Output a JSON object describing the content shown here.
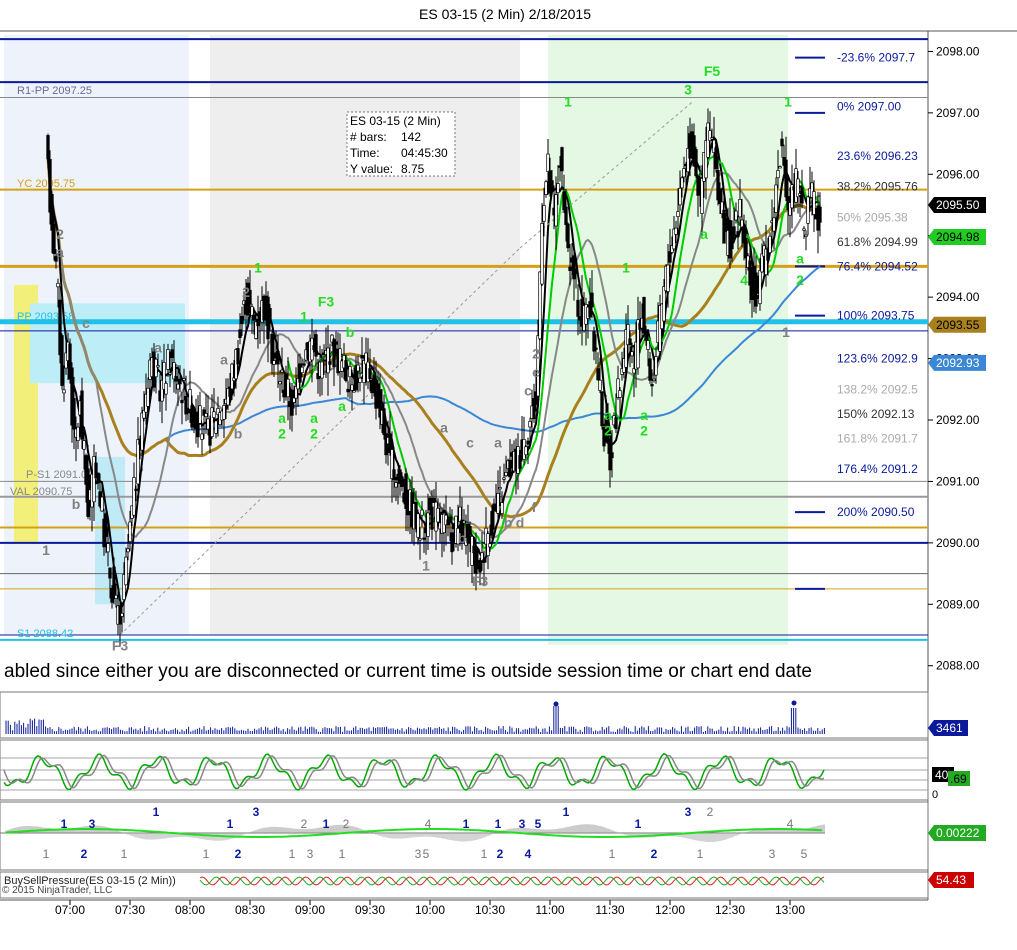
{
  "title": "ES 03-15 (2 Min)  2/18/2015",
  "colors": {
    "up": "#00c800",
    "down": "#000000",
    "navy": "#0a1a9a",
    "gold": "#d4a017",
    "brown": "#a8801e",
    "cyan": "#1fc1e8",
    "blue_ma": "#3a87d6",
    "gray_ma": "#888888",
    "label_green": "#22dd22",
    "label_gray": "#808080"
  },
  "chart_data": [
    {
      "type": "candlestick",
      "name": "price-panel",
      "title": "ES 03-15 (2 Min)  2/18/2015",
      "ylim": [
        2087.8,
        2098.3
      ],
      "y_ticks": [
        "2098.00",
        "2097.00",
        "2096.00",
        "2095.00",
        "2094.00",
        "2093.00",
        "2092.00",
        "2091.00",
        "2090.00",
        "2089.00",
        "2088.00"
      ],
      "x_ticks": [
        "07:00",
        "07:30",
        "08:00",
        "08:30",
        "09:00",
        "09:30",
        "10:00",
        "10:30",
        "11:00",
        "11:30",
        "12:00",
        "12:30",
        "13:00"
      ],
      "grid": false,
      "price_markers": [
        {
          "label": "2095.50",
          "value": 2095.5,
          "bg": "#000000",
          "fg": "#ffffff"
        },
        {
          "label": "2094.98",
          "value": 2094.98,
          "bg": "#22cc22",
          "fg": "#000000"
        },
        {
          "label": "2093.55",
          "value": 2093.55,
          "bg": "#a8801e",
          "fg": "#000000"
        },
        {
          "label": "2092.93",
          "value": 2092.93,
          "bg": "#3a87d6",
          "fg": "#ffffff"
        }
      ],
      "levels": [
        {
          "label": "R1-PP 2097.25",
          "value": 2097.25,
          "color": "#0a1a9a"
        },
        {
          "label": "YC 2095.75",
          "value": 2095.75,
          "color": "#d4a017"
        },
        {
          "label": "PP 2093.58",
          "value": 2093.58,
          "color": "#1fc1e8"
        },
        {
          "label": "P-S1 2091.00",
          "value": 2091.0,
          "color": "#888888"
        },
        {
          "label": "VAL 2090.75",
          "value": 2090.75,
          "color": "#888888"
        },
        {
          "label": "S1 2088.42",
          "value": 2088.42,
          "color": "#1fc1e8"
        }
      ],
      "fib_labels": [
        {
          "label": "-23.6%  2097.7",
          "value": 2097.9,
          "color": "#0a1a9a"
        },
        {
          "label": "0%  2097.00",
          "value": 2097.1,
          "color": "#0a1a9a"
        },
        {
          "label": "23.6%  2096.23",
          "value": 2096.3,
          "color": "#0a1a9a"
        },
        {
          "label": "38.2%  2095.76",
          "value": 2095.8,
          "color": "#333333"
        },
        {
          "label": "50%  2095.38",
          "value": 2095.3,
          "color": "#aaaaaa"
        },
        {
          "label": "61.8%  2094.99",
          "value": 2094.9,
          "color": "#333333"
        },
        {
          "label": "76.4%  2094.52",
          "value": 2094.5,
          "color": "#0a1a9a"
        },
        {
          "label": "100%  2093.75",
          "value": 2093.7,
          "color": "#0a1a9a"
        },
        {
          "label": "123.6%  2092.9",
          "value": 2093.0,
          "color": "#0a1a9a"
        },
        {
          "label": "138.2%  2092.5",
          "value": 2092.5,
          "color": "#aaaaaa"
        },
        {
          "label": "150%  2092.13",
          "value": 2092.1,
          "color": "#333333"
        },
        {
          "label": "161.8%  2091.7",
          "value": 2091.7,
          "color": "#aaaaaa"
        },
        {
          "label": "176.4%  2091.2",
          "value": 2091.2,
          "color": "#0a1a9a"
        },
        {
          "label": "200%  2090.50",
          "value": 2090.5,
          "color": "#0a1a9a"
        }
      ],
      "info_box": {
        "rows": [
          [
            "ES 03-15 (2 Min)",
            ""
          ],
          [
            "# bars:",
            "142"
          ],
          [
            "Time:",
            "04:45:30"
          ],
          [
            "Y value:",
            "8.75"
          ]
        ]
      },
      "banner": "abled since either you are disconnected or current time is outside session time or chart end date",
      "wave_labels": [
        {
          "t": "2",
          "time": "06:55",
          "y": 2094.95,
          "c": "gray"
        },
        {
          "t": "a",
          "time": "06:55",
          "y": 2094.65,
          "c": "gray"
        },
        {
          "t": "c",
          "time": "07:08",
          "y": 2093.5,
          "c": "gray"
        },
        {
          "t": "b",
          "time": "07:03",
          "y": 2090.55,
          "c": "gray"
        },
        {
          "t": "1",
          "time": "06:48",
          "y": 2089.8,
          "c": "gray"
        },
        {
          "t": "F3",
          "time": "07:25",
          "y": 2088.25,
          "c": "gray"
        },
        {
          "t": "a",
          "time": "07:44",
          "y": 2093.1,
          "c": "gray"
        },
        {
          "t": "a",
          "time": "08:17",
          "y": 2092.9,
          "c": "gray"
        },
        {
          "t": "b",
          "time": "08:24",
          "y": 2091.7,
          "c": "gray"
        },
        {
          "t": "2",
          "time": "08:28",
          "y": 2094.0,
          "c": "gray"
        },
        {
          "t": "1",
          "time": "08:34",
          "y": 2094.4,
          "c": "green"
        },
        {
          "t": "1",
          "time": "08:57",
          "y": 2093.6,
          "c": "green"
        },
        {
          "t": "F3",
          "time": "09:08",
          "y": 2093.85,
          "c": "green"
        },
        {
          "t": "b",
          "time": "09:20",
          "y": 2093.35,
          "c": "green"
        },
        {
          "t": "a",
          "time": "08:46",
          "y": 2091.95,
          "c": "green"
        },
        {
          "t": "2",
          "time": "08:46",
          "y": 2091.7,
          "c": "green"
        },
        {
          "t": "a",
          "time": "09:02",
          "y": 2091.95,
          "c": "green"
        },
        {
          "t": "2",
          "time": "09:02",
          "y": 2091.7,
          "c": "green"
        },
        {
          "t": "a",
          "time": "09:16",
          "y": 2092.15,
          "c": "green"
        },
        {
          "t": "a",
          "time": "10:07",
          "y": 2091.8,
          "c": "gray"
        },
        {
          "t": "c",
          "time": "10:20",
          "y": 2091.55,
          "c": "gray"
        },
        {
          "t": "a",
          "time": "10:34",
          "y": 2091.55,
          "c": "gray"
        },
        {
          "t": "b",
          "time": "10:16",
          "y": 2090.0,
          "c": "gray"
        },
        {
          "t": "1",
          "time": "09:58",
          "y": 2089.55,
          "c": "gray"
        },
        {
          "t": "F3",
          "time": "10:25",
          "y": 2089.3,
          "c": "gray"
        },
        {
          "t": "b",
          "time": "10:39",
          "y": 2090.25,
          "c": "gray"
        },
        {
          "t": "d",
          "time": "10:45",
          "y": 2090.25,
          "c": "gray"
        },
        {
          "t": "f",
          "time": "10:52",
          "y": 2090.5,
          "c": "gray"
        },
        {
          "t": "c",
          "time": "10:49",
          "y": 2092.4,
          "c": "gray"
        },
        {
          "t": "2",
          "time": "10:53",
          "y": 2093.0,
          "c": "gray"
        },
        {
          "t": "e",
          "time": "10:53",
          "y": 2092.7,
          "c": "gray"
        },
        {
          "t": "1",
          "time": "11:09",
          "y": 2097.1,
          "c": "green"
        },
        {
          "t": "a",
          "time": "11:29",
          "y": 2092.0,
          "c": "green"
        },
        {
          "t": "2",
          "time": "11:29",
          "y": 2091.75,
          "c": "green"
        },
        {
          "t": "1",
          "time": "11:38",
          "y": 2094.4,
          "c": "green"
        },
        {
          "t": "a",
          "time": "11:47",
          "y": 2092.0,
          "c": "green"
        },
        {
          "t": "2",
          "time": "11:47",
          "y": 2091.75,
          "c": "green"
        },
        {
          "t": "3",
          "time": "12:09",
          "y": 2097.3,
          "c": "green"
        },
        {
          "t": "F5",
          "time": "12:21",
          "y": 2097.6,
          "c": "green"
        },
        {
          "t": "a",
          "time": "12:17",
          "y": 2094.95,
          "c": "green"
        },
        {
          "t": "4",
          "time": "12:37",
          "y": 2094.2,
          "c": "green"
        },
        {
          "t": "1",
          "time": "12:59",
          "y": 2097.1,
          "c": "green"
        },
        {
          "t": "1",
          "time": "12:58",
          "y": 2093.35,
          "c": "gray"
        },
        {
          "t": "a",
          "time": "13:05",
          "y": 2094.55,
          "c": "green"
        },
        {
          "t": "2",
          "time": "13:05",
          "y": 2094.2,
          "c": "green"
        }
      ],
      "ma_overlays": [
        "blue",
        "brown",
        "gray",
        "black",
        "green"
      ]
    },
    {
      "type": "bar",
      "name": "volume-panel",
      "marker": "3461",
      "marker_color": "#0a1a9a"
    },
    {
      "type": "line",
      "name": "stochastics-panel",
      "y_ticks": [
        "0"
      ],
      "markers": [
        {
          "label": "40",
          "bg": "#000000",
          "fg": "#ffffff"
        },
        {
          "label": ".69",
          "bg": "#22aa22",
          "fg": "#000000"
        }
      ]
    },
    {
      "type": "bar",
      "name": "histogram-panel",
      "marker": "0.00222",
      "marker_color": "#22aa22",
      "labels": [
        {
          "t": "1",
          "time": "06:48",
          "c": "gray",
          "lvl": "low"
        },
        {
          "t": "1",
          "time": "06:57",
          "c": "navy",
          "lvl": "high"
        },
        {
          "t": "2",
          "time": "07:07",
          "c": "navy",
          "lvl": "low"
        },
        {
          "t": "3",
          "time": "07:11",
          "c": "navy",
          "lvl": "high"
        },
        {
          "t": "1",
          "time": "07:27",
          "c": "gray",
          "lvl": "low"
        },
        {
          "t": "1",
          "time": "07:43",
          "c": "navy",
          "lvl": "top"
        },
        {
          "t": "1",
          "time": "08:08",
          "c": "gray",
          "lvl": "low"
        },
        {
          "t": "1",
          "time": "08:20",
          "c": "navy",
          "lvl": "high"
        },
        {
          "t": "2",
          "time": "08:24",
          "c": "navy",
          "lvl": "low"
        },
        {
          "t": "3",
          "time": "08:33",
          "c": "navy",
          "lvl": "top"
        },
        {
          "t": "1",
          "time": "08:51",
          "c": "gray",
          "lvl": "low"
        },
        {
          "t": "2",
          "time": "08:57",
          "c": "gray",
          "lvl": "high"
        },
        {
          "t": "3",
          "time": "09:00",
          "c": "gray",
          "lvl": "low"
        },
        {
          "t": "1",
          "time": "09:08",
          "c": "navy",
          "lvl": "high"
        },
        {
          "t": "1",
          "time": "09:16",
          "c": "gray",
          "lvl": "low"
        },
        {
          "t": "2",
          "time": "09:18",
          "c": "gray",
          "lvl": "high"
        },
        {
          "t": "3",
          "time": "09:54",
          "c": "gray",
          "lvl": "low"
        },
        {
          "t": "4",
          "time": "09:59",
          "c": "gray",
          "lvl": "high"
        },
        {
          "t": "5",
          "time": "09:58",
          "c": "gray",
          "lvl": "low"
        },
        {
          "t": "1",
          "time": "10:18",
          "c": "navy",
          "lvl": "high"
        },
        {
          "t": "1",
          "time": "10:27",
          "c": "gray",
          "lvl": "low"
        },
        {
          "t": "1",
          "time": "10:34",
          "c": "navy",
          "lvl": "high"
        },
        {
          "t": "2",
          "time": "10:35",
          "c": "navy",
          "lvl": "low"
        },
        {
          "t": "3",
          "time": "10:46",
          "c": "navy",
          "lvl": "high"
        },
        {
          "t": "4",
          "time": "10:49",
          "c": "navy",
          "lvl": "low"
        },
        {
          "t": "5",
          "time": "10:54",
          "c": "navy",
          "lvl": "high"
        },
        {
          "t": "1",
          "time": "11:08",
          "c": "navy",
          "lvl": "top"
        },
        {
          "t": "1",
          "time": "11:31",
          "c": "gray",
          "lvl": "low"
        },
        {
          "t": "1",
          "time": "11:44",
          "c": "navy",
          "lvl": "high"
        },
        {
          "t": "2",
          "time": "11:52",
          "c": "navy",
          "lvl": "low"
        },
        {
          "t": "3",
          "time": "12:09",
          "c": "navy",
          "lvl": "top"
        },
        {
          "t": "2",
          "time": "12:20",
          "c": "gray",
          "lvl": "top"
        },
        {
          "t": "1",
          "time": "12:15",
          "c": "gray",
          "lvl": "low"
        },
        {
          "t": "3",
          "time": "12:51",
          "c": "gray",
          "lvl": "low"
        },
        {
          "t": "4",
          "time": "13:00",
          "c": "gray",
          "lvl": "high"
        },
        {
          "t": "5",
          "time": "13:07",
          "c": "gray",
          "lvl": "low"
        }
      ]
    },
    {
      "type": "line",
      "name": "buysellpressure-panel",
      "label": "BuySellPressure(ES 03-15 (2 Min))",
      "marker": "54.43",
      "marker_color": "#cc0000"
    }
  ],
  "copyright": "© 2015 NinjaTrader, LLC"
}
